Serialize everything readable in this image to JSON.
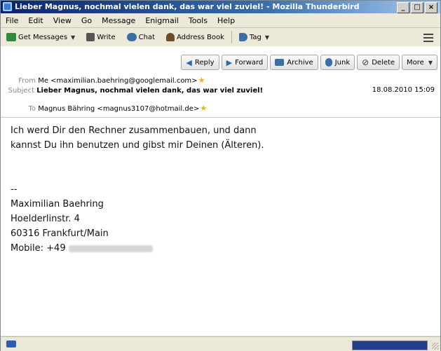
{
  "window": {
    "title": "Lieber Magnus, nochmal vielen dank, das war viel zuviel! - Mozilla Thunderbird",
    "controls": {
      "minimize": "_",
      "maximize": "□",
      "close": "×"
    }
  },
  "menu": [
    "File",
    "Edit",
    "View",
    "Go",
    "Message",
    "Enigmail",
    "Tools",
    "Help"
  ],
  "toolbar": {
    "get_messages": "Get Messages",
    "write": "Write",
    "chat": "Chat",
    "address_book": "Address Book",
    "tag": "Tag",
    "icons": [
      "download-arrow-icon",
      "pencil-icon",
      "chat-bubble-icon",
      "person-icon",
      "tag-icon",
      "menu-icon"
    ]
  },
  "actions": {
    "reply": "Reply",
    "forward": "Forward",
    "archive": "Archive",
    "junk": "Junk",
    "delete": "Delete",
    "more": "More"
  },
  "headers": {
    "from_label": "From",
    "from_value": "Me <maximilian.baehring@googlemail.com>",
    "subject_label": "Subject",
    "subject_value": "Lieber Magnus, nochmal vielen dank, das war viel zuviel!",
    "date": "18.08.2010 15:09",
    "to_label": "To",
    "to_value": "Magnus Bähring <magnus3107@hotmail.de>"
  },
  "body": {
    "lines": [
      "Ich werd Dir den Rechner zusammenbauen, und dann",
      "kannst Du ihn benutzen und gibst mir Deinen (Älteren)."
    ],
    "sig_separator": "--",
    "sig_name": "Maximilian Baehring",
    "sig_street": "Hoelderlinstr. 4",
    "sig_city": "60316 Frankfurt/Main",
    "sig_mobile": "Mobile: +49"
  },
  "status": {
    "progress": 1.0
  },
  "colors": {
    "title_bar": "#0a246a",
    "star": "#f0b400",
    "progress_fill": "#1f3f8a"
  }
}
